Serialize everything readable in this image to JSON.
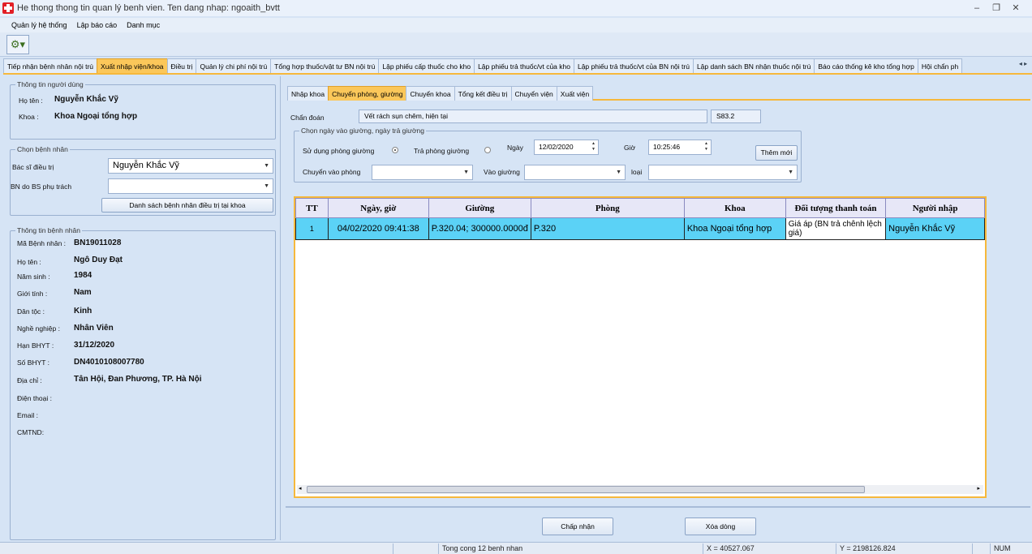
{
  "window": {
    "title": "He thong thong tin quan lý benh vien. Ten dang nhap: ngoaith_bvtt"
  },
  "menu": [
    "Quản lý hệ thống",
    "Lập báo cáo",
    "Danh mục"
  ],
  "main_tabs": [
    "Tiếp nhận bệnh nhân nội trú",
    "Xuất nhập viện/khoa",
    "Điều trị",
    "Quản lý chi phí nội trú",
    "Tổng hợp thuốc/vật tư BN nội trú",
    "Lập phiếu cấp thuốc cho kho",
    "Lập phiếu trả thuốc/vt của kho",
    "Lập phiếu trả thuốc/vt của BN nội trú",
    "Lập danh sách BN nhận thuốc nội trú",
    "Báo cáo thống kê kho tổng hợp",
    "Hội chẩn ph"
  ],
  "user_info": {
    "group": "Thông tin người dùng",
    "name_label": "Họ tên :",
    "name": "Nguyễn Khắc Vỹ",
    "dept_label": "Khoa :",
    "dept": "Khoa Ngoại tổng hợp"
  },
  "choose_patient": {
    "group": "Chọn bệnh nhân",
    "doctor_label": "Bác sĩ điều trị",
    "doctor": "Nguyễn Khắc Vỹ",
    "bs_label": "BN do BS phụ trách",
    "bs_value": "",
    "list_button": "Danh sách bệnh nhân điều trị tại khoa"
  },
  "patient": {
    "group": "Thông tin bệnh nhân",
    "fields": [
      {
        "label": "Mã Bệnh nhân :",
        "value": "BN19011028"
      },
      {
        "label": "Họ tên :",
        "value": "Ngô Duy Đạt"
      },
      {
        "label": "Năm sinh :",
        "value": "1984"
      },
      {
        "label": "Giới tính :",
        "value": "Nam"
      },
      {
        "label": "Dân tộc :",
        "value": "Kinh"
      },
      {
        "label": "Nghề nghiệp :",
        "value": "Nhân Viên"
      },
      {
        "label": "Hạn BHYT :",
        "value": "31/12/2020"
      },
      {
        "label": "Số BHYT :",
        "value": "DN4010108007780"
      },
      {
        "label": "Địa chỉ :",
        "value": "Tân Hội, Đan Phương, TP. Hà Nội"
      },
      {
        "label": "Điện thoại :",
        "value": ""
      },
      {
        "label": "Email :",
        "value": ""
      },
      {
        "label": "CMTND:",
        "value": ""
      }
    ]
  },
  "sub_tabs": [
    "Nhập khoa",
    "Chuyển phòng, giường",
    "Chuyển khoa",
    "Tổng kết điều trị",
    "Chuyển viện",
    "Xuất viện"
  ],
  "diagnosis": {
    "label": "Chẩn đoán",
    "value": "Vết rách sụn chêm, hiện tại",
    "code": "S83.2"
  },
  "bed_group": {
    "title": "Chọn ngày vào giường, ngày trả giường",
    "use_room_label": "Sử dụng phòng giường",
    "return_room_label": "Trả phòng giường",
    "date_label": "Ngày",
    "date": "12/02/2020",
    "time_label": "Giờ",
    "time": "10:25:46",
    "add_button": "Thêm mới",
    "room_label": "Chuyển vào phòng",
    "bed_label": "Vào giường",
    "type_label": "loại"
  },
  "grid": {
    "headers": [
      "TT",
      "Ngày, giờ",
      "Giường",
      "Phòng",
      "Khoa",
      "Đối tượng thanh toán",
      "Người nhập"
    ],
    "rows": [
      [
        "1",
        "04/02/2020 09:41:38",
        "P.320.04; 300000.0000đ",
        "P.320",
        "Khoa Ngoại tổng hợp",
        "Giá áp (BN trả chênh lệch giá)",
        "Nguyễn Khắc Vỹ"
      ]
    ]
  },
  "buttons": {
    "accept": "Chấp nhận",
    "delete": "Xóa dòng"
  },
  "status": {
    "count": "Tong cong 12 benh nhan",
    "x": "X = 40527.067",
    "y": "Y = 2198126.824",
    "num": "NUM"
  },
  "colors": {
    "active_tab": "#fbc75a",
    "selected_row": "#5bd2f6",
    "background": "#d6e4f5"
  }
}
